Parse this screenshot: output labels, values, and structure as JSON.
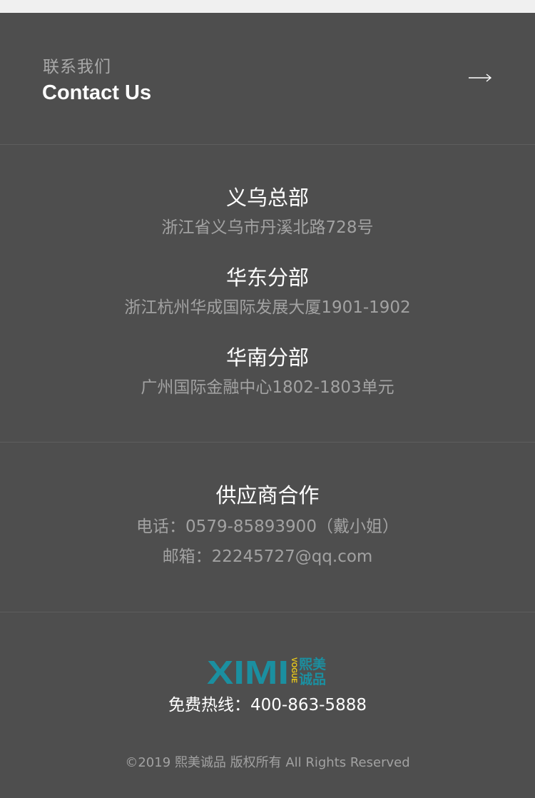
{
  "contact": {
    "title_cn": "联系我们",
    "title_en": "Contact Us",
    "arrow_icon": "arrow-right-icon"
  },
  "offices": [
    {
      "name": "义乌总部",
      "address": "浙江省义乌市丹溪北路728号"
    },
    {
      "name": "华东分部",
      "address": "浙江杭州华成国际发展大厦1901-1902"
    },
    {
      "name": "华南分部",
      "address": "广州国际金融中心1802-1803单元"
    }
  ],
  "supplier": {
    "title": "供应商合作",
    "phone": "电话：0579-85893900（戴小姐）",
    "email": "邮箱：22245727@qq.com"
  },
  "footer": {
    "logo_text": "XIMI",
    "logo_side_text": "VOGUE",
    "logo_cn_top": "熙美",
    "logo_cn_bottom": "诚品",
    "hotline": "免费热线：400-863-5888",
    "copyright": "©2019 熙美诚品 版权所有 All Rights Reserved"
  },
  "colors": {
    "background": "#4e4e4e",
    "logo_teal": "#1b8fa0",
    "logo_yellow": "#e8c81a"
  }
}
